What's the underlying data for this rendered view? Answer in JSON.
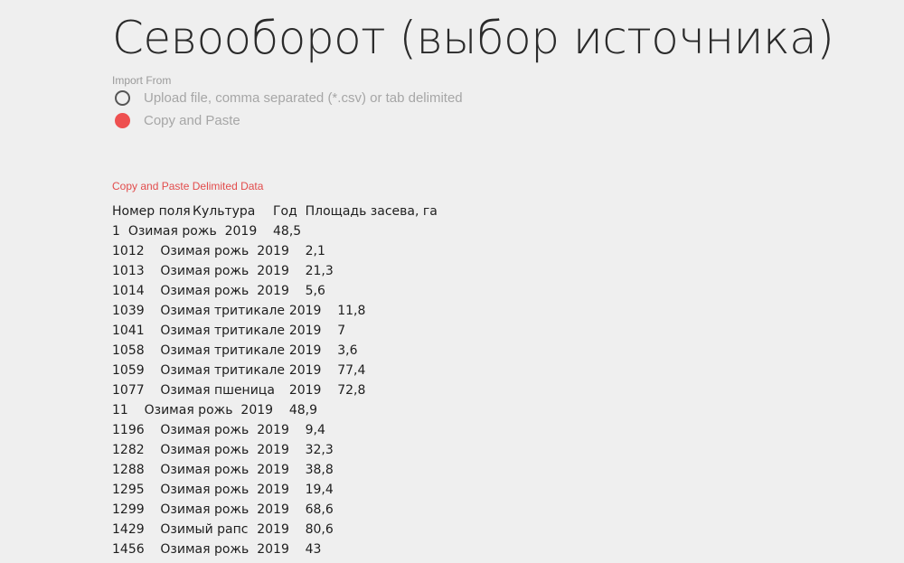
{
  "title": "Севооборот (выбор источника)",
  "import": {
    "label": "Import From",
    "options": [
      {
        "label": "Upload file, comma separated (*.csv) or tab delimited",
        "selected": false
      },
      {
        "label": "Copy and Paste",
        "selected": true
      }
    ]
  },
  "paste": {
    "label": "Copy and Paste Delimited Data",
    "lines": [
      "Номер поля\tКультура\tГод\tПлощадь засева, га",
      "1\tОзимая рожь\t2019\t48,5",
      "1012\tОзимая рожь\t2019\t2,1",
      "1013\tОзимая рожь\t2019\t21,3",
      "1014\tОзимая рожь\t2019\t5,6",
      "1039\tОзимая тритикале\t2019\t11,8",
      "1041\tОзимая тритикале\t2019\t7",
      "1058\tОзимая тритикале\t2019\t3,6",
      "1059\tОзимая тритикале\t2019\t77,4",
      "1077\tОзимая пшеница\t2019\t72,8",
      "11\tОзимая рожь\t2019\t48,9",
      "1196\tОзимая рожь\t2019\t9,4",
      "1282\tОзимая рожь\t2019\t32,3",
      "1288\tОзимая рожь\t2019\t38,8",
      "1295\tОзимая рожь\t2019\t19,4",
      "1299\tОзимая рожь\t2019\t68,6",
      "1429\tОзимый рапс\t2019\t80,6",
      "1456\tОзимая рожь\t2019\t43"
    ]
  },
  "colors": {
    "accent": "#ee5050",
    "background": "#efefef"
  }
}
